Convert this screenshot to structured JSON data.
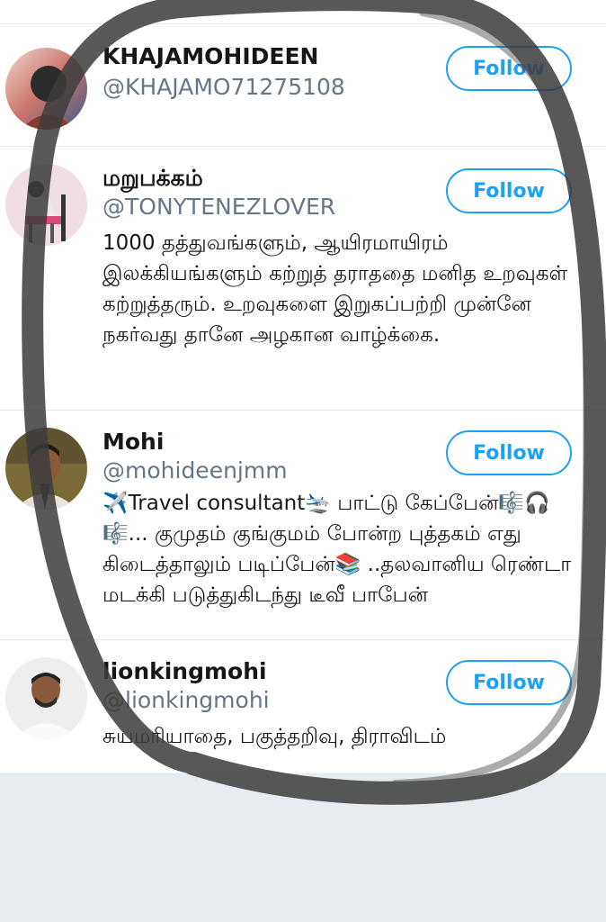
{
  "users": [
    {
      "name": "KHAJAMOHIDEEN",
      "handle": "@KHAJAMO71275108",
      "bio": "",
      "follow_label": "Follow",
      "avatar_icon": "avatar-photo"
    },
    {
      "name": "மறுபக்கம்",
      "handle": "@TONYTENEZLOVER",
      "bio": "1000 தத்துவங்களும், ஆயிரமாயிரம் இலக்கியங்களும் கற்றுத் தராததை மனித உறவுகள் கற்றுத்தரும். உறவுகளை இறுகப்பற்றி முன்னே நகர்வது தானே அழகான வாழ்க்கை.",
      "follow_label": "Follow",
      "avatar_icon": "avatar-photo"
    },
    {
      "name": "Mohi",
      "handle": "@mohideenjmm",
      "bio": "✈️Travel consultant🛬 பாட்டு கேப்பேன்🎼🎧🎼... குமுதம் குங்குமம் போன்ற புத்தகம் எது கிடைத்தாலும் படிப்பேன்📚 ..தலவானிய ரெண்டா மடக்கி படுத்துகிடந்து டீவீ பாபேன்",
      "follow_label": "Follow",
      "avatar_icon": "avatar-photo"
    },
    {
      "name": "lionkingmohi",
      "handle": "@lionkingmohi",
      "bio": "சுயமரியாதை, பகுத்தறிவு, திராவிடம்",
      "follow_label": "Follow",
      "avatar_icon": "avatar-photo"
    }
  ],
  "colors": {
    "accent": "#1da1f2",
    "handle": "#657786",
    "divider": "#e1e8ed",
    "footer_bg": "#e6ecf0",
    "scribble": "#3c3c3c"
  }
}
